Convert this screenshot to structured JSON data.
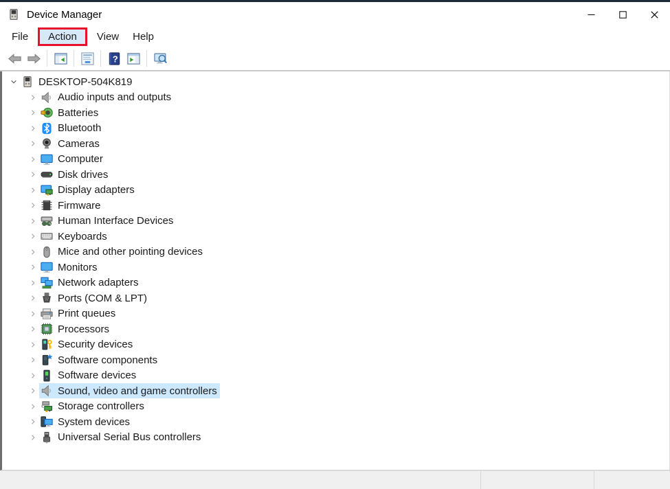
{
  "window": {
    "title": "Device Manager",
    "controls": [
      {
        "name": "minimize"
      },
      {
        "name": "maximize"
      },
      {
        "name": "close"
      }
    ]
  },
  "menu_bar": {
    "items": [
      {
        "label": "File"
      },
      {
        "label": "Action",
        "highlighted": true
      },
      {
        "label": "View"
      },
      {
        "label": "Help"
      }
    ]
  },
  "toolbar": {
    "buttons": [
      {
        "name": "back-button",
        "icon": "back-arrow-icon"
      },
      {
        "name": "forward-button",
        "icon": "forward-arrow-icon"
      },
      {
        "sep": true
      },
      {
        "name": "show-hide-console-tree-button",
        "icon": "console-tree-icon"
      },
      {
        "sep": true
      },
      {
        "name": "properties-button",
        "icon": "properties-icon"
      },
      {
        "sep": true
      },
      {
        "name": "help-button",
        "icon": "help-icon"
      },
      {
        "name": "show-hide-action-pane-button",
        "icon": "action-pane-icon"
      },
      {
        "sep": true
      },
      {
        "name": "scan-hardware-changes-button",
        "icon": "scan-icon"
      }
    ]
  },
  "tree": {
    "root": {
      "label": "DESKTOP-504K819",
      "icon": "computer-device-icon",
      "expanded": true
    },
    "items": [
      {
        "label": "Audio inputs and outputs",
        "icon": "speaker-icon"
      },
      {
        "label": "Batteries",
        "icon": "battery-icon"
      },
      {
        "label": "Bluetooth",
        "icon": "bluetooth-icon"
      },
      {
        "label": "Cameras",
        "icon": "camera-icon"
      },
      {
        "label": "Computer",
        "icon": "monitor-icon"
      },
      {
        "label": "Disk drives",
        "icon": "disk-icon"
      },
      {
        "label": "Display adapters",
        "icon": "display-adapter-icon"
      },
      {
        "label": "Firmware",
        "icon": "firmware-icon"
      },
      {
        "label": "Human Interface Devices",
        "icon": "hid-icon"
      },
      {
        "label": "Keyboards",
        "icon": "keyboard-icon"
      },
      {
        "label": "Mice and other pointing devices",
        "icon": "mouse-icon"
      },
      {
        "label": "Monitors",
        "icon": "monitor-icon"
      },
      {
        "label": "Network adapters",
        "icon": "network-icon"
      },
      {
        "label": "Ports (COM & LPT)",
        "icon": "ports-icon"
      },
      {
        "label": "Print queues",
        "icon": "printer-icon"
      },
      {
        "label": "Processors",
        "icon": "processor-icon"
      },
      {
        "label": "Security devices",
        "icon": "security-icon"
      },
      {
        "label": "Software components",
        "icon": "software-component-icon"
      },
      {
        "label": "Software devices",
        "icon": "software-device-icon"
      },
      {
        "label": "Sound, video and game controllers",
        "icon": "speaker-icon",
        "selected": true
      },
      {
        "label": "Storage controllers",
        "icon": "storage-icon"
      },
      {
        "label": "System devices",
        "icon": "system-icon"
      },
      {
        "label": "Universal Serial Bus controllers",
        "icon": "usb-icon"
      }
    ]
  },
  "status_bar": {
    "sections": [
      "",
      "",
      ""
    ]
  },
  "colors": {
    "selection_highlight": "#cce8ff",
    "annotation_red": "#e8112d",
    "menu_hover_blue": "#d7e9f9",
    "statusbar_gray": "#f0f0f0",
    "top_strip": "#1c2a3a"
  }
}
